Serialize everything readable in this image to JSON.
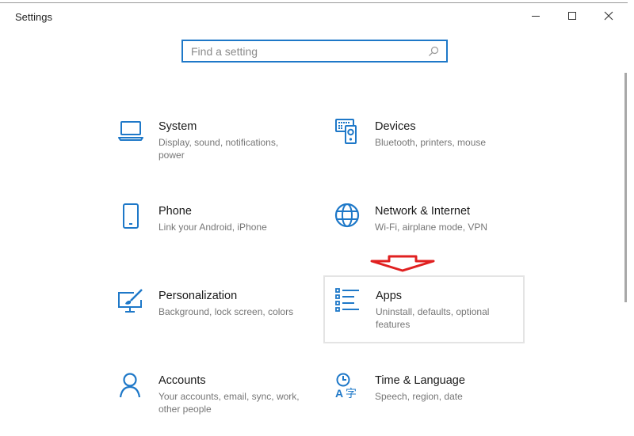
{
  "window": {
    "title": "Settings",
    "minimize_label": "Minimize",
    "maximize_label": "Maximize",
    "close_label": "Close"
  },
  "search": {
    "placeholder": "Find a setting",
    "value": "",
    "icon": "search-icon"
  },
  "accent_color": "#1e78c8",
  "annotation_color": "#e02020",
  "tiles": [
    {
      "id": "system",
      "name": "System",
      "description": "Display, sound, notifications, power",
      "icon": "laptop-icon"
    },
    {
      "id": "devices",
      "name": "Devices",
      "description": "Bluetooth, printers, mouse",
      "icon": "devices-icon"
    },
    {
      "id": "phone",
      "name": "Phone",
      "description": "Link your Android, iPhone",
      "icon": "phone-icon"
    },
    {
      "id": "network",
      "name": "Network & Internet",
      "description": "Wi-Fi, airplane mode, VPN",
      "icon": "globe-icon"
    },
    {
      "id": "personalization",
      "name": "Personalization",
      "description": "Background, lock screen, colors",
      "icon": "paintbrush-monitor-icon"
    },
    {
      "id": "apps",
      "name": "Apps",
      "description": "Uninstall, defaults, optional features",
      "icon": "apps-list-icon",
      "highlighted": true
    },
    {
      "id": "accounts",
      "name": "Accounts",
      "description": "Your accounts, email, sync, work, other people",
      "icon": "person-icon"
    },
    {
      "id": "time-language",
      "name": "Time & Language",
      "description": "Speech, region, date",
      "icon": "time-language-icon"
    }
  ]
}
